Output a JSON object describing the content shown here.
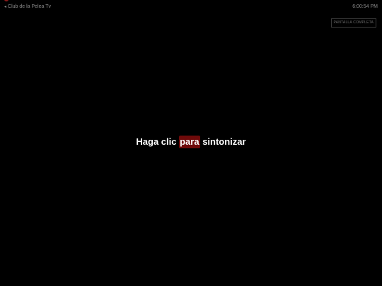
{
  "header": {
    "top_fragment_label": "",
    "channel_link_label": "Club de la Pelea Tv",
    "back_arrow": "◂",
    "clock": "6:00:54 PM"
  },
  "toolbar": {
    "fullscreen_label": "PANTALLA COMPLETA"
  },
  "player": {
    "tune_before": "Haga clic ",
    "tune_highlight": "para",
    "tune_after": " sintonizar"
  },
  "colors": {
    "background": "#000000",
    "highlight": "#6e0a0a",
    "muted_text": "#8c8c8c"
  }
}
